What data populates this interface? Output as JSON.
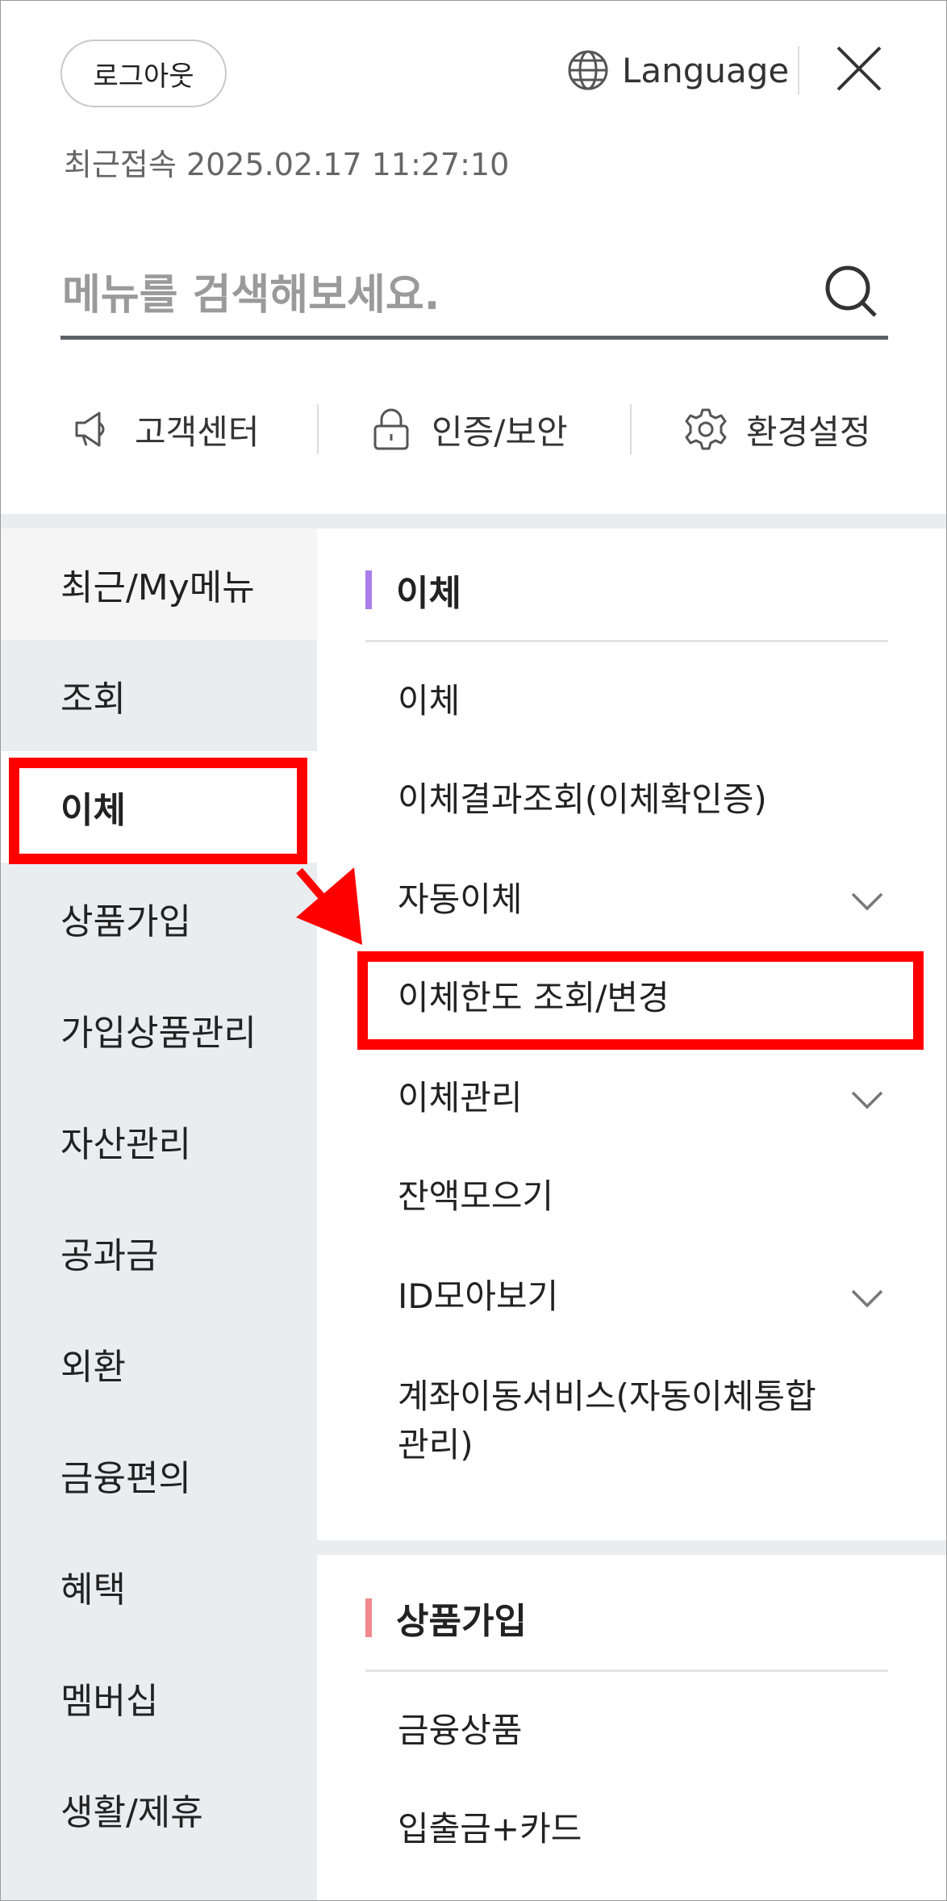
{
  "header": {
    "logout_label": "로그아웃",
    "language_label": "Language",
    "last_access_label": "최근접속",
    "last_access_value": "2025.02.17 11:27:10"
  },
  "search": {
    "placeholder": "메뉴를 검색해보세요."
  },
  "quick_links": [
    {
      "label": "고객센터",
      "icon": "megaphone-icon"
    },
    {
      "label": "인증/보안",
      "icon": "lock-icon"
    },
    {
      "label": "환경설정",
      "icon": "gear-icon"
    }
  ],
  "left_menu": {
    "items": [
      {
        "label": "최근/My메뉴"
      },
      {
        "label": "조회"
      },
      {
        "label": "이체"
      },
      {
        "label": "상품가입"
      },
      {
        "label": "가입상품관리"
      },
      {
        "label": "자산관리"
      },
      {
        "label": "공과금"
      },
      {
        "label": "외환"
      },
      {
        "label": "금융편의"
      },
      {
        "label": "혜택"
      },
      {
        "label": "멤버십"
      },
      {
        "label": "생활/제휴"
      }
    ],
    "active_index": 2
  },
  "right_menu": {
    "sections": [
      {
        "title": "이체",
        "accent": "#a97de8",
        "items": [
          {
            "label": "이체"
          },
          {
            "label": "이체결과조회(이체확인증)"
          },
          {
            "label": "자동이체",
            "expandable": true
          },
          {
            "label": "이체한도 조회/변경"
          },
          {
            "label": "이체관리",
            "expandable": true
          },
          {
            "label": "잔액모으기"
          },
          {
            "label": "ID모아보기",
            "expandable": true
          },
          {
            "label": "계좌이동서비스(자동이체통합관리)"
          }
        ]
      },
      {
        "title": "상품가입",
        "accent": "#f08a8e",
        "items": [
          {
            "label": "금융상품"
          },
          {
            "label": "입출금+카드"
          }
        ]
      }
    ]
  },
  "colors": {
    "highlight": "#ff0000",
    "left_bg": "#e9edf0",
    "search_underline": "#5c6068"
  }
}
